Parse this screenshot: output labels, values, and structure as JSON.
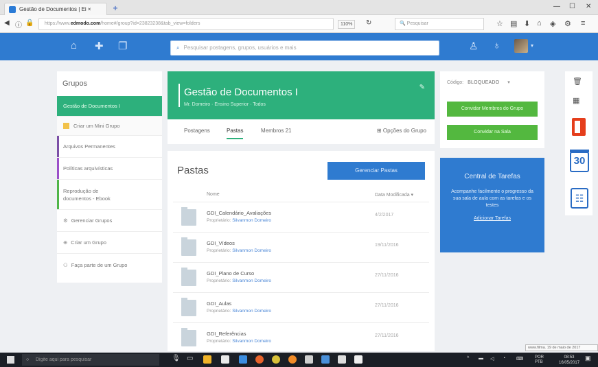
{
  "browser": {
    "tab_title": "Gestão de Documentos | Ei ×",
    "url_prefix": "https://www.",
    "url_domain": "edmodo.com",
    "url_rest": "/home#/group?id=23823238&tab_view=folders",
    "zoom": "110%",
    "search_placeholder": "Pesquisar"
  },
  "app": {
    "search_placeholder": "Pesquisar postagens, grupos, usuários e mais",
    "brand_color": "#2f7bd0",
    "accent_green": "#2db07c"
  },
  "sidebar": {
    "title": "Grupos",
    "items": [
      {
        "label": "Gestão de Documentos I"
      },
      {
        "label": "Criar um Mini Grupo"
      },
      {
        "label": "Arquivos Permanentes"
      },
      {
        "label": "Políticas arquivísticas"
      },
      {
        "label": "Reprodução de documentos - Ebook"
      },
      {
        "label": "Gerenciar Grupos"
      },
      {
        "label": "Criar um Grupo"
      },
      {
        "label": "Faça parte de um Grupo"
      }
    ]
  },
  "group": {
    "title": "Gestão de Documentos I",
    "subtitle": "Mr. Domeiro · Ensino Superior · Todos",
    "tabs": [
      "Postagens",
      "Pastas",
      "Membros 21"
    ],
    "options": "Opções do Grupo"
  },
  "folders": {
    "title": "Pastas",
    "manage_button": "Gerenciar Pastas",
    "col_name": "Nome",
    "col_date": "Data Modificada ▾",
    "owner_label": "Proprietário:",
    "rows": [
      {
        "name": "GDI_Calendário_Avaliações",
        "owner": "Silvanmon Domeiro",
        "date": "4/2/2017"
      },
      {
        "name": "GDI_Vídeos",
        "owner": "Silvanmon Domeiro",
        "date": "19/11/2016"
      },
      {
        "name": "GDI_Plano de Curso",
        "owner": "Silvanmon Domeiro",
        "date": "27/11/2016"
      },
      {
        "name": "GDI_Aulas",
        "owner": "Silvanmon Domeiro",
        "date": "27/11/2016"
      },
      {
        "name": "GDI_Referências",
        "owner": "Silvanmon Domeiro",
        "date": "27/11/2016"
      }
    ]
  },
  "right": {
    "code_label": "Código:",
    "code_value": "BLOQUEADO",
    "btn_invite": "Convidar Membros do Grupo",
    "btn_share": "Convidar na Sala"
  },
  "tasks": {
    "title": "Central de Tarefas",
    "desc": "Acompanhe facilmente o progresso da sua sala de aula com as tarefas e os testes",
    "link": "Adicionar Tarefas"
  },
  "tooltip": "www.filma. 19 de maio de 2017",
  "taskbar": {
    "search_placeholder": "Digite aqui para pesquisar",
    "lang": "POR PTB",
    "time": "08:53",
    "date": "16/05/2017"
  }
}
